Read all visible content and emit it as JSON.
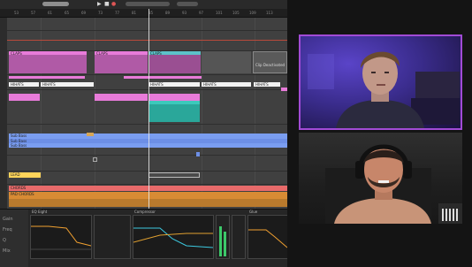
{
  "daw": {
    "transport": {
      "tempo_readout": "",
      "play_glyph": "▶",
      "stop_glyph": "■",
      "record_glyph": "●"
    },
    "ruler_numbers": [
      "53",
      "57",
      "61",
      "65",
      "69",
      "73",
      "77",
      "81",
      "85",
      "89",
      "93",
      "97",
      "101",
      "105",
      "109",
      "113",
      "117"
    ],
    "tracks": [
      {
        "label": "CLAPS",
        "color": "#e87bd9"
      },
      {
        "label": "HIHATS",
        "color": "#e87bd9"
      },
      {
        "label": "PERC",
        "color": "#e87bd9"
      },
      {
        "label": "BASS",
        "color": "#7fb1ff"
      },
      {
        "label": "LEAD",
        "color": "#ffd45a"
      },
      {
        "label": "CHORDS",
        "color": "#e86a6a"
      },
      {
        "label": "PAD",
        "color": "#e7a044"
      }
    ],
    "clip_labels": {
      "top_a": "CLAPS",
      "top_b": "CLAPS",
      "top_c": "CLAPS",
      "white_a": "HIHATS",
      "white_b": "HIHATS",
      "white_c": "HIHATS",
      "white_d": "HIHATS",
      "white_e": "HIHATS",
      "blue_a": "Sub Bass",
      "blue_b": "Sub Bass",
      "blue_c": "Sub Bass",
      "yellow": "LEAD",
      "red": "CHORDS",
      "orange": "PAD CHORDS"
    },
    "side_note": "Clip Deactivated"
  },
  "fx": {
    "left_labels": [
      "Gain",
      "Freq",
      "Q",
      "Mix"
    ],
    "device_a": "EQ Eight",
    "device_b": "Compressor",
    "device_c": "Glue"
  },
  "video": {
    "top_border_color": "#a24bd6"
  }
}
